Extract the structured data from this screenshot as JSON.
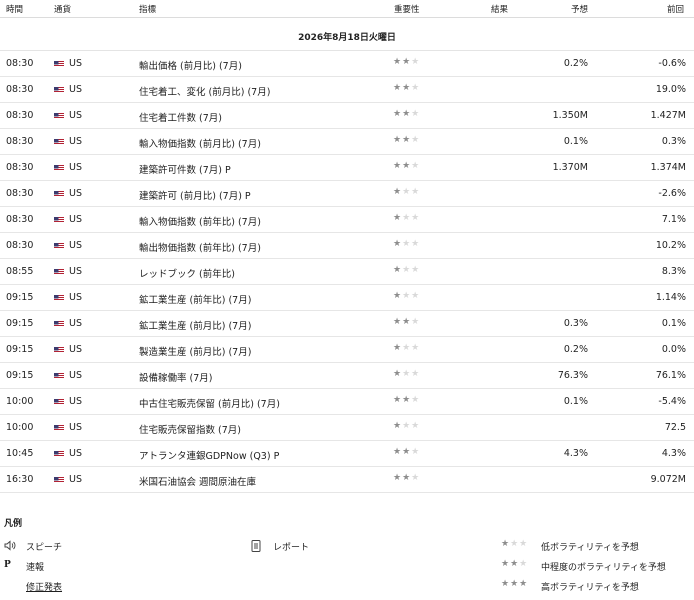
{
  "columns": {
    "time": "時間",
    "currency": "通貨",
    "indicator": "指標",
    "importance": "重要性",
    "result": "結果",
    "forecast": "予想",
    "previous": "前回"
  },
  "date_label": "2026年8月18日火曜日",
  "rows": [
    {
      "time": "08:30",
      "currency": "US",
      "indicator": "輸出価格 (前月比) (7月)",
      "stars": 2,
      "result": "",
      "forecast": "0.2%",
      "previous": "-0.6%"
    },
    {
      "time": "08:30",
      "currency": "US",
      "indicator": "住宅着工、変化 (前月比) (7月)",
      "stars": 2,
      "result": "",
      "forecast": "",
      "previous": "19.0%"
    },
    {
      "time": "08:30",
      "currency": "US",
      "indicator": "住宅着工件数  (7月)",
      "stars": 2,
      "result": "",
      "forecast": "1.350M",
      "previous": "1.427M"
    },
    {
      "time": "08:30",
      "currency": "US",
      "indicator": "輸入物価指数 (前月比) (7月)",
      "stars": 2,
      "result": "",
      "forecast": "0.1%",
      "previous": "0.3%"
    },
    {
      "time": "08:30",
      "currency": "US",
      "indicator": "建築許可件数  (7月)   P",
      "stars": 2,
      "result": "",
      "forecast": "1.370M",
      "previous": "1.374M"
    },
    {
      "time": "08:30",
      "currency": "US",
      "indicator": "建築許可 (前月比) (7月)   P",
      "stars": 1,
      "result": "",
      "forecast": "",
      "previous": "-2.6%"
    },
    {
      "time": "08:30",
      "currency": "US",
      "indicator": "輸入物価指数 (前年比) (7月)",
      "stars": 1,
      "result": "",
      "forecast": "",
      "previous": "7.1%"
    },
    {
      "time": "08:30",
      "currency": "US",
      "indicator": "輸出物価指数 (前年比) (7月)",
      "stars": 1,
      "result": "",
      "forecast": "",
      "previous": "10.2%"
    },
    {
      "time": "08:55",
      "currency": "US",
      "indicator": "レッドブック (前年比)",
      "stars": 1,
      "result": "",
      "forecast": "",
      "previous": "8.3%"
    },
    {
      "time": "09:15",
      "currency": "US",
      "indicator": "鉱工業生産 (前年比) (7月)",
      "stars": 1,
      "result": "",
      "forecast": "",
      "previous": "1.14%"
    },
    {
      "time": "09:15",
      "currency": "US",
      "indicator": "鉱工業生産 (前月比) (7月)",
      "stars": 2,
      "result": "",
      "forecast": "0.3%",
      "previous": "0.1%"
    },
    {
      "time": "09:15",
      "currency": "US",
      "indicator": "製造業生産 (前月比) (7月)",
      "stars": 1,
      "result": "",
      "forecast": "0.2%",
      "previous": "0.0%"
    },
    {
      "time": "09:15",
      "currency": "US",
      "indicator": "設備稼働率  (7月)",
      "stars": 1,
      "result": "",
      "forecast": "76.3%",
      "previous": "76.1%"
    },
    {
      "time": "10:00",
      "currency": "US",
      "indicator": "中古住宅販売保留 (前月比) (7月)",
      "stars": 2,
      "result": "",
      "forecast": "0.1%",
      "previous": "-5.4%"
    },
    {
      "time": "10:00",
      "currency": "US",
      "indicator": "住宅販売保留指数  (7月)",
      "stars": 1,
      "result": "",
      "forecast": "",
      "previous": "72.5"
    },
    {
      "time": "10:45",
      "currency": "US",
      "indicator": "アトランタ連銀GDPNow  (Q3)   P",
      "stars": 2,
      "result": "",
      "forecast": "4.3%",
      "previous": "4.3%"
    },
    {
      "time": "16:30",
      "currency": "US",
      "indicator": "米国石油協会 週間原油在庫",
      "stars": 2,
      "result": "",
      "forecast": "",
      "previous": "9.072M"
    }
  ],
  "legend": {
    "title": "凡例",
    "speech": "スピーチ",
    "breaking_mark": "P",
    "breaking": "速報",
    "revised": "修正発表",
    "report": "レポート",
    "low_vol": "低ボラティリティを予想",
    "mid_vol": "中程度のボラティリティを予想",
    "high_vol": "高ボラティリティを予想"
  },
  "icons": {
    "flag": "us-flag-icon",
    "star": "star-icon",
    "speech": "speaker-icon",
    "report": "document-icon"
  },
  "colors": {
    "star_on": "#8d8d8d",
    "star_off": "#d9d9d9",
    "flag_red": "#b22234",
    "flag_blue": "#3c3b6e"
  }
}
